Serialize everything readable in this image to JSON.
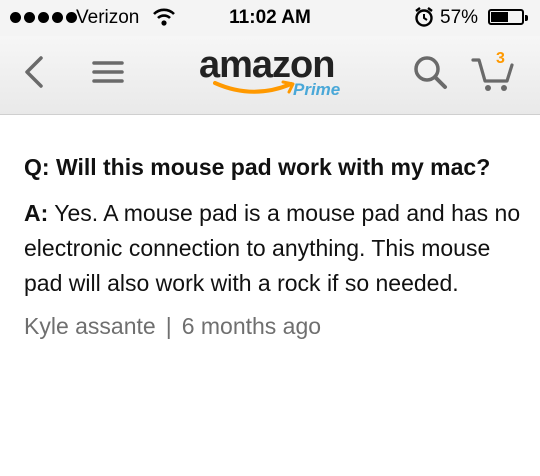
{
  "status_bar": {
    "carrier": "Verizon",
    "time": "11:02 AM",
    "battery_percent": "57%",
    "battery_level": 0.57
  },
  "header": {
    "logo_text": "amazon",
    "logo_sub": "Prime",
    "cart_count": "3",
    "brand_color": "#ff9900",
    "icons": [
      "back-icon",
      "menu-icon",
      "search-icon",
      "cart-icon"
    ]
  },
  "qa": {
    "question": "Q: Will this mouse pad work with my mac?",
    "answer_prefix": "A:",
    "answer": "Yes. A mouse pad is a mouse pad and has no electronic connection to anything. This mouse pad will also work with a rock if so needed.",
    "author": "Kyle assante",
    "separator": "|",
    "age": "6 months ago"
  }
}
